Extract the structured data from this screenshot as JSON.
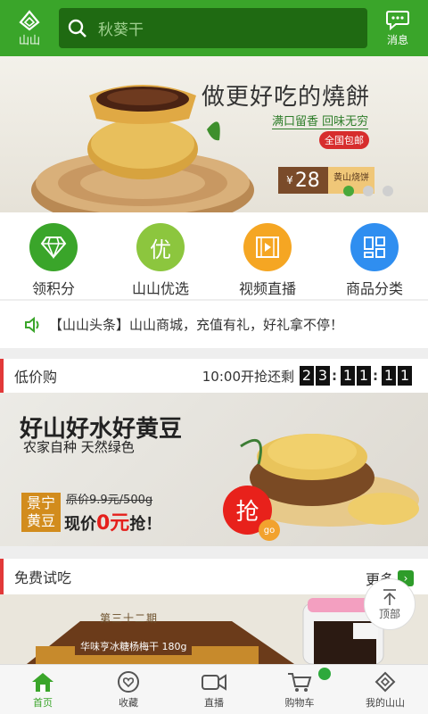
{
  "header": {
    "logo_label": "山山",
    "search_placeholder": "秋葵干",
    "message_label": "消息"
  },
  "banner": {
    "title": "做更好吃的燒餅",
    "subtitle": "满口留香 回味无穷",
    "shipping": "全国包邮",
    "price_currency": "¥",
    "price": "28",
    "price_tag": "黄山烧饼",
    "slides": 3,
    "active_slide": 0
  },
  "quick_links": [
    {
      "label": "领积分",
      "icon": "diamond-icon",
      "color": "#3aa52a"
    },
    {
      "label": "山山优选",
      "icon": "you-icon",
      "color": "#8cc63e",
      "glyph": "优"
    },
    {
      "label": "视频直播",
      "icon": "film-icon",
      "color": "#f5a623"
    },
    {
      "label": "商品分类",
      "icon": "category-icon",
      "color": "#2f8ef0"
    }
  ],
  "news": {
    "text": "【山山头条】山山商城，充值有礼，好礼拿不停！"
  },
  "flash_sale": {
    "title": "低价购",
    "countdown_label": "10:00开抢还剩",
    "digits": [
      "2",
      "3",
      "1",
      "1",
      "1",
      "1"
    ]
  },
  "promo": {
    "title": "好山好水好黄豆",
    "subtitle": "农家自种 天然绿色",
    "label": "景宁黄豆",
    "original_price": "原价9.9元/500g",
    "now_prefix": "现价",
    "now_price": "0元",
    "now_suffix": "抢！",
    "grab": "抢",
    "go": "go"
  },
  "free_trial": {
    "title": "免费试吃",
    "more": "更多",
    "issue": "第三十二期",
    "product": "华味亨冰糖杨梅干 180g"
  },
  "back_to_top": "顶部",
  "tabs": [
    {
      "label": "首页",
      "icon": "home-icon",
      "active": true
    },
    {
      "label": "收藏",
      "icon": "heart-icon",
      "active": false
    },
    {
      "label": "直播",
      "icon": "video-icon",
      "active": false
    },
    {
      "label": "购物车",
      "icon": "cart-icon",
      "active": false
    },
    {
      "label": "我的山山",
      "icon": "user-icon",
      "active": false
    }
  ]
}
